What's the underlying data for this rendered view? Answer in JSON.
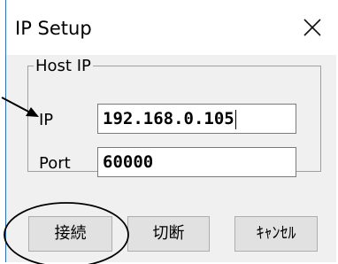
{
  "window": {
    "title": "IP Setup",
    "close_glyph": "X"
  },
  "group": {
    "legend": "Host IP"
  },
  "fields": {
    "ip_label": "IP",
    "ip_value": "192.168.0.105",
    "port_label": "Port",
    "port_value": "60000"
  },
  "buttons": {
    "connect": "接続",
    "disconnect": "切断",
    "cancel": "ｷｬﾝｾﾙ"
  },
  "annotations": {
    "arrow": "pointing-arrow",
    "ellipse": "highlight-ellipse",
    "color": "#000000"
  }
}
